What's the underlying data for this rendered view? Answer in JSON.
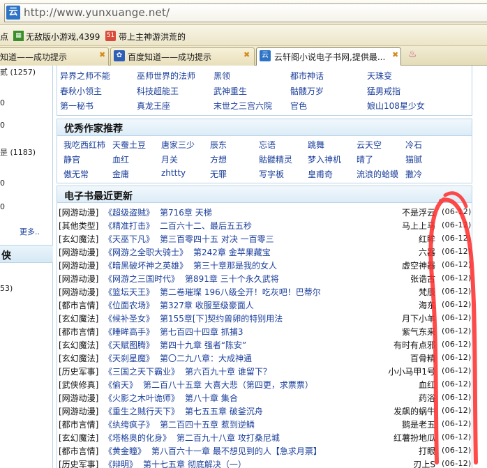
{
  "browser": {
    "url": "http://www.yunxuange.net/",
    "bookmarks": [
      {
        "label": "点",
        "icon": ""
      },
      {
        "label": "无敌版小游戏,4399",
        "icon": "grid-icon"
      },
      {
        "label": "带上主神游洪荒的",
        "icon": "book-icon"
      }
    ],
    "tabs": [
      {
        "label": "知道——成功提示",
        "active": false
      },
      {
        "label": "百度知道——成功提示",
        "active": false
      },
      {
        "label": "云轩阁小说电子书网,提供最...",
        "active": true
      }
    ]
  },
  "sidebar": {
    "lines": [
      "贰 (1257)",
      "0",
      "0",
      "昰 (1183)",
      "0",
      "0"
    ],
    "more": "更多..",
    "head": "侠",
    "bottom": "53)"
  },
  "top_links": [
    [
      "异界之师不能",
      "巫师世界的法师",
      "黑领",
      "都市神话",
      "天珠变"
    ],
    [
      "春秋小领主",
      "科技超能王",
      "武神重生",
      "骷髅万岁",
      "猛男戒指"
    ],
    [
      "第一秘书",
      "真龙王座",
      "末世之三宫六院",
      "官色",
      "娘山108星少女"
    ]
  ],
  "authors_panel": {
    "title": "优秀作家推荐",
    "rows": [
      [
        "我吃西红柿",
        "天蚕土豆",
        "唐家三少",
        "辰东",
        "忘语",
        "跳舞",
        "云天空",
        "冷石"
      ],
      [
        "静官",
        "血红",
        "月关",
        "方想",
        "骷髅精灵",
        "梦入神机",
        "晴了",
        "猫腻"
      ],
      [
        "傲无常",
        "金庸",
        "zhttty",
        "无罪",
        "写字板",
        "皇甫奇",
        "流浪的蛤蟆",
        "撒冷"
      ]
    ]
  },
  "updates_panel": {
    "title": "电子书最近更新",
    "rows": [
      {
        "cat": "[网游动漫]",
        "title": "《超级盗贼》",
        "chapter": "第716章 天梯",
        "author": "不是浮云",
        "date": "06-12"
      },
      {
        "cat": "[其他类型]",
        "title": "《精准打击》",
        "chapter": "二百六十二、最后五五秒",
        "author": "马上上马",
        "date": "06-12"
      },
      {
        "cat": "[玄幻魔法]",
        "title": "《天巫下凡》",
        "chapter": "第三百零四十五 对决 一百零三",
        "author": "红眸",
        "date": "06-12"
      },
      {
        "cat": "[网游动漫]",
        "title": "《网游之全职大骑士》",
        "chapter": "第242章 金苹果藏宝",
        "author": "六器",
        "date": "06-12"
      },
      {
        "cat": "[网游动漫]",
        "title": "《暗黑破坏神之英雄》",
        "chapter": "第三十章那是我的女人",
        "author": "虚空神器",
        "date": "06-12"
      },
      {
        "cat": "[网游动漫]",
        "title": "《网游之三国时代》",
        "chapter": "第891章 三十个永久武将",
        "author": "张诰古",
        "date": "06-12"
      },
      {
        "cat": "[网游动漫]",
        "title": "《篮坛天王》",
        "chapter": "第二卷璀璨 196八级全开！吃灰吧！巴蒂尔",
        "author": "梵辰",
        "date": "06-12"
      },
      {
        "cat": "[都市言情]",
        "title": "《位面农场》",
        "chapter": "第327章 收服至级豪面人",
        "author": "海东",
        "date": "06-12"
      },
      {
        "cat": "[玄幻魔法]",
        "title": "《候补圣女》",
        "chapter": "第155章[下]契约兽卵的特别用法",
        "author": "月下小羊",
        "date": "06-12"
      },
      {
        "cat": "[都市言情]",
        "title": "《睡眸高手》",
        "chapter": "第七百四十四章 抓捕3",
        "author": "紫气东来",
        "date": "06-12"
      },
      {
        "cat": "[玄幻魔法]",
        "title": "《天赋图腾》",
        "chapter": "第四十九章 强者“陈安”",
        "author": "有时有点邪",
        "date": "06-12"
      },
      {
        "cat": "[玄幻魔法]",
        "title": "《天刹星魔》",
        "chapter": "第〇二九八章：大成神通",
        "author": "百骨精",
        "date": "06-12"
      },
      {
        "cat": "[历史军事]",
        "title": "《三国之天下霸业》",
        "chapter": "第六百九十章 谁留下？",
        "author": "小小马甲1号",
        "date": "06-12"
      },
      {
        "cat": "[武侠修真]",
        "title": "《偷天》",
        "chapter": "第二百八十五章 大喜大悲（第四更，求票票）",
        "author": "血红",
        "date": "06-12"
      },
      {
        "cat": "[网游动漫]",
        "title": "《火影之木叶诡师》",
        "chapter": "第八十章 集合",
        "author": "药浴",
        "date": "06-12"
      },
      {
        "cat": "[网游动漫]",
        "title": "《重生之贼行天下》",
        "chapter": "第七五五章 破釜沉舟",
        "author": "发飙的蜗牛",
        "date": "06-12"
      },
      {
        "cat": "[都市言情]",
        "title": "《纨绔疯子》",
        "chapter": "第二百四十五章 惹到逆鳞",
        "author": "鹅是老五",
        "date": "06-12"
      },
      {
        "cat": "[玄幻魔法]",
        "title": "《塔格奥的化身》",
        "chapter": "第二百九十八章 攻打桑尼城",
        "author": "红薯扮地瓜",
        "date": "06-12"
      },
      {
        "cat": "[都市言情]",
        "title": "《黄金瞳》",
        "chapter": "第八百六十一章 最不想见到的人【急求月票】",
        "author": "打眼",
        "date": "06-12"
      },
      {
        "cat": "[历史军事]",
        "title": "《辩明》",
        "chapter": "第十七五章 彻底解决（一）",
        "author": "刃上S",
        "date": "06-12"
      }
    ]
  },
  "colors": {
    "link": "#1a3e9a",
    "annotation": "#ff2a2a",
    "panel_border": "#b9d3e6"
  }
}
